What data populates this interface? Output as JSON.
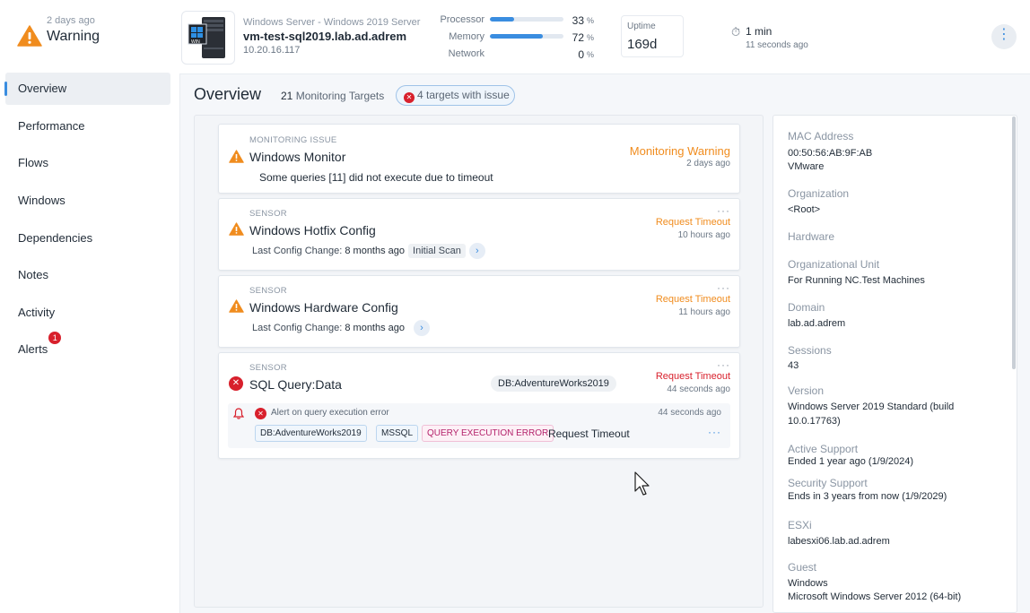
{
  "header": {
    "status_age": "2 days ago",
    "status": "Warning",
    "os": "Windows Server - Windows 2019 Server",
    "server_name": "vm-test-sql2019.lab.ad.adrem",
    "ip": "10.20.16.117",
    "server_icon_label": "WIN",
    "metrics": [
      {
        "label": "Processor",
        "value": "33",
        "unit": "%",
        "fraction": 0.33
      },
      {
        "label": "Memory",
        "value": "72",
        "unit": "%",
        "fraction": 0.72
      },
      {
        "label": "Network",
        "value": "0",
        "unit": "%",
        "fraction": 0.0
      }
    ],
    "uptime_label": "Uptime",
    "uptime_value": "169d",
    "poll_interval": "1 min",
    "poll_ago": "11 seconds ago",
    "more_icon": "kebab-icon"
  },
  "nav": {
    "items": [
      {
        "label": "Overview"
      },
      {
        "label": "Performance"
      },
      {
        "label": "Flows"
      },
      {
        "label": "Windows"
      },
      {
        "label": "Dependencies"
      },
      {
        "label": "Notes"
      },
      {
        "label": "Activity"
      },
      {
        "label": "Alerts",
        "badge": "1"
      }
    ]
  },
  "overview": {
    "title": "Overview",
    "targets_count": "21",
    "targets_label": "Monitoring Targets",
    "issues_count": "4",
    "issues_label": "targets with issue",
    "cards": [
      {
        "category": "MONITORING ISSUE",
        "title": "Windows Monitor",
        "status": "Monitoring Warning",
        "ago": "2 days ago",
        "message": "Some queries [11] did not execute due to timeout"
      },
      {
        "category": "SENSOR",
        "title": "Windows Hotfix Config",
        "status": "Request Timeout",
        "ago": "10 hours ago",
        "change_label": "Last Config Change:",
        "change_value": "8 months ago",
        "tag": "Initial Scan"
      },
      {
        "category": "SENSOR",
        "title": "Windows Hardware Config",
        "status": "Request Timeout",
        "ago": "11 hours ago",
        "change_label": "Last Config Change:",
        "change_value": "8 months ago"
      },
      {
        "category": "SENSOR",
        "title": "SQL Query:Data",
        "db": "DB:AdventureWorks2019",
        "status": "Request Timeout",
        "ago": "44 seconds ago",
        "alert": {
          "text": "Alert on query execution error",
          "ago": "44 seconds ago",
          "chips": [
            "DB:AdventureWorks2019",
            "MSSQL",
            "QUERY EXECUTION ERROR"
          ],
          "result": "Request Timeout"
        }
      }
    ]
  },
  "properties": [
    {
      "label": "MAC Address",
      "values": [
        "00:50:56:AB:9F:AB",
        "VMware"
      ]
    },
    {
      "label": "Organization",
      "values": [
        "<Root>"
      ]
    },
    {
      "label": "Hardware",
      "values": []
    },
    {
      "label": "Organizational Unit",
      "values": [
        "For Running NC.Test Machines"
      ]
    },
    {
      "label": "Domain",
      "values": [
        "lab.ad.adrem"
      ]
    },
    {
      "label": "Sessions",
      "values": [
        "43"
      ]
    },
    {
      "label": "Version",
      "values": [
        "Windows Server 2019 Standard (build",
        "10.0.17763)"
      ]
    },
    {
      "label": "Active Support",
      "values": [
        "Ended 1 year ago (1/9/2024)"
      ]
    },
    {
      "label": "Security Support",
      "values": [
        "Ends in 3 years from now (1/9/2029)"
      ]
    },
    {
      "label": "ESXi",
      "values": [
        "labesxi06.lab.ad.adrem"
      ]
    },
    {
      "label": "Guest",
      "values": [
        "Windows",
        "Microsoft Windows Server 2012 (64-bit)"
      ]
    }
  ],
  "colors": {
    "warning": "#f08c1e",
    "error": "#d8202c",
    "accent": "#3a8de0"
  }
}
